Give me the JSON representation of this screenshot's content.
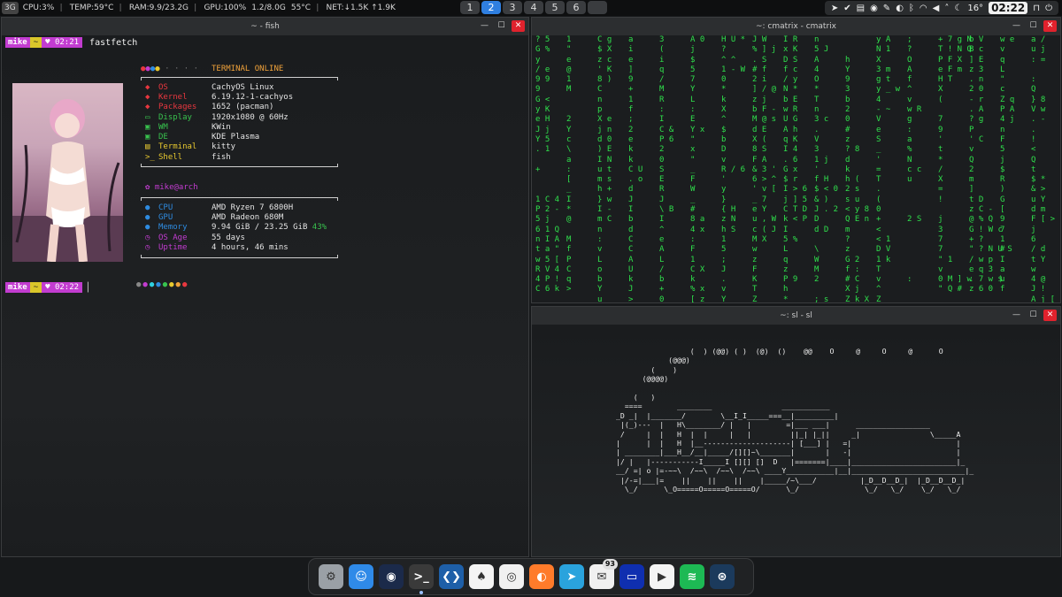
{
  "topbar": {
    "logo": "3G",
    "cpu": "CPU:3%",
    "temp": "TEMP:59°C",
    "ram": "RAM:9.9/23.2G",
    "gpu": "GPU:100%",
    "vram": "1.2/8.0G",
    "gpu_temp": "55°C",
    "net": "NET:↓1.5K ↑1.9K",
    "workspaces": [
      "1",
      "2",
      "3",
      "4",
      "5",
      "6"
    ],
    "active_workspace": "2",
    "weather": "16°",
    "clock": "02:22"
  },
  "fish_window": {
    "title": "~ - fish",
    "prompt": {
      "user": "mike",
      "dir": "~",
      "time1": "02:21",
      "time2": "02:22",
      "heart": "♥"
    },
    "command": "fastfetch",
    "header": "TERMINAL ONLINE",
    "rows1": [
      {
        "icon": "",
        "label": "OS",
        "value": "CachyOS Linux",
        "color": "#e8373f"
      },
      {
        "icon": "",
        "label": "Kernel",
        "value": "6.19.12-1-cachyos",
        "color": "#e8373f"
      },
      {
        "icon": "",
        "label": "Packages",
        "value": "1652 (pacman)",
        "color": "#e8373f"
      },
      {
        "icon": "",
        "label": "Display",
        "value": "1920x1080 @ 60Hz",
        "color": "#38c24e"
      },
      {
        "icon": "",
        "label": "WM",
        "value": "KWin",
        "color": "#38c24e"
      },
      {
        "icon": "",
        "label": "DE",
        "value": "KDE Plasma",
        "color": "#38c24e"
      },
      {
        "icon": "",
        "label": "Terminal",
        "value": "kitty",
        "color": "#e8c92f"
      },
      {
        "icon": "",
        "label": "Shell",
        "value": "fish",
        "color": "#e8c92f"
      }
    ],
    "user_host": "mike@arch",
    "rows2": [
      {
        "label": "CPU",
        "value": "AMD Ryzen 7 6800H",
        "color": "#2e8be0"
      },
      {
        "label": "GPU",
        "value": "AMD Radeon 680M",
        "color": "#2e8be0"
      },
      {
        "label": "Memory",
        "value": "9.94 GiB / 23.25 GiB",
        "extra": "43%",
        "color": "#2e8be0"
      },
      {
        "label": "OS Age",
        "value": "55 days",
        "color": "#c23cd0"
      },
      {
        "label": "Uptime",
        "value": "4 hours, 46 mins",
        "color": "#c23cd0"
      }
    ],
    "palette": [
      "#888888",
      "#c23cd0",
      "#2fd0e0",
      "#2e8be0",
      "#38c24e",
      "#e8c92f",
      "#f0a23a",
      "#e8373f"
    ]
  },
  "matrix_window": {
    "title": "~: cmatrix - cmatrix",
    "columns": [
      "? 5\nG %\ny\n/ e\n9 9\n9\nG <\ny K\ne H\nJ j\nY 5\n. 1\n\n+\n\n\n1 C 4\nP 2 -\n5 j\n6 1 Q\nn I A\nt a \"\nw 5 [\nR V 4\n4 P !\nC 6 k",
      "1\n\"\ne\n@\n1\nM\n\n\n2\nY\nc\n\\\na\n:\n[\n_\nI\n*\n@\n\nM\nf\nP\nC\nq\n>",
      "C g\n$ X\nz c\n' K\n8 )\nC\nn\np\nX e\nj n\nd 0\n) E\nI N\nu t\nm s\nh +\n} w\nI -\nm C\nn\n:\nv\nL\no\nb\nY\nu",
      "a\ni\ne\n]\n9\n+\n1\nf\n;\n2\ne\nk\nk\nC U\n. o\nd\nJ\nI\nb\nd\nC\nC\nA\nU\nk\nJ\n>",
      "3\n(\ni\nq\n/\nM\nR\n:\nI\nC &\nP 6\n2\n0\nS\nE\nR\nJ\n\\ B\nI\n^\ne\nA\nL\n/\nb\n+\n0",
      "A 0\nj\n$\n5\n7\nY\nL\n:\nE\nY x\n\"\nx\n\"\n_\nF\nW\n_\n#\n8 a\n4 x\n:\nF\n1\nC X\nk\n% x\n[ z",
      "H U *\n?\n^ ^\n1 - W\n0\n*\nk\nX\n^\n$\nb\nD\nv\nR / 6\n'\ny\n}\n{ H\nz N\nh S\n1\n5\n;\nJ\n.\nv\nY",
      "J W\n% ] j\n. S\n# f\n2 i\n] / @\nz j\nb F -\nM @ s\nd E\nX (\n8 S\nF A\n& 3 '\n6 > ^\n' v [\n_ 7\ne Y\nu , W\nc ( J\nM X\nw\nz\nF\nK\nT\nZ",
      "I R\nx K\nD S\nf c\n/ y\nN *\nb E\nw R\nU G\nA h\nq K\nI 4\n. 6\nG x\n$ r\nI > 6\nj ] 5\nC T D\nk < P\nI\n5 %\nL\nq\nz\nP 9\nh\n*\n'",
      "n\n5 J\nA\n4\nO\n*\nT\nn\n3 c\n.\nV\n3\n1 j\n'\nf H\n$ < 0\n& )\nJ . 2\nD\nd D\n\n\\\nW\nM\n2\n\n; s",
      "\n\nh\nY\n9\n3\nb\n2\n0\n#\nz\n? 8\nd\nk\nh (\n2 s\ns u\n< y 8\nQ E n\nm\n?\nz\nG 2\nf :\n# C\nX j\nZ k X",
      "y A\nN 1\nX\n3 m\ng t\ny _ w\n4\n- ~\nV\ne\nS\n_\n'\n=\nT\n.\n(\n0\n+\n<\n< 1\nD V\n1 k\nT\nv\n^\nZ",
      ";\n?\nO\nA\nf\n^\nv\nw R\ng\n:\na\n%\nN\nc c\nu\n\n\n\n2 S\n\n\n\n\n\n:\n\n",
      "+ 7 g N\nT ! N Q\nP F X\ne F m\nH T\nX\n(\n\n7\n9\n'\nt\n*\n/\nX\n=\n!\n\nj\n3\n7\n7\n\" 1\nv\n0 M ] w\n\" Q #",
      "b V\nB c\n] E\nz 3\n. n\n2 0\n- r\n. A\n? g\nP\n' C\nv\nQ\n2\nm\n]\nt D\nz C -\n@ % Q\nG ! W c\n+ ?\n\" ? N U S\n/ w p\ne q 3\n. 7 w $\nz 6 0",
      "w e\nv\nq\nL\n\"\nc\nZ q\nP A\n4 j\nn\nF\n5\nj\n$\nR\n)\nG\n[\n9\n7\n1\n#\nI\na\nu\nf",
      "a /\nu j\n: =\n\n:\nQ\n} 8\nV w\n. -\n.\n!\n<\nQ\nt\n$ *\n& >\nu Y\nd m\nF [ > 0\nj\n6\n/ d\nt Y\nw\n4 @\nJ !\nA j [\ne n t"
    ]
  },
  "sl_window": {
    "title": "~: sl - sl",
    "train": "                 (  ) (@@) ( )  (@)  ()    @@    O     @     O     @      O\n            (@@@)\n        (    )\n      (@@@@)\n\n    (   )\n  ====        ________                ___________\n_D _|  |_______/        \\__I_I_____===__|_________|\n |(_)---  |   H\\________/ |   |        =|___ ___|      _________________\n /     |  |   H  |  |     |   |         ||_| |_||     _|                \\_____A\n|      |  |   H  |__--------------------| [___] |   =|                        |\n| ________|___H__/__|_____/[][]~\\_______|       |   -|                        |\n|/ |   |-----------I_____I [][] []  D   |=======|____|________________________|_\n__/ =| o |=-~~\\  /~~\\  /~~\\  /~~\\ ____Y___________|__|__________________________|_\n |/-=|___|=    ||    ||    ||    |_____/~\\___/          |_D__D__D_|  |_D__D__D_|\n  \\_/      \\_O=====O=====O=====O/      \\_/               \\_/   \\_/    \\_/   \\_/"
  },
  "dock": [
    {
      "name": "system-settings-icon",
      "label": "⚙",
      "bg": "#9aa0a6"
    },
    {
      "name": "finder-icon",
      "label": "☺",
      "bg": "#2f8ae8"
    },
    {
      "name": "discover-icon",
      "label": "◉",
      "bg": "#1b2a4a"
    },
    {
      "name": "terminal-icon",
      "label": ">_",
      "bg": "#3a3a3a"
    },
    {
      "name": "vscode-icon",
      "label": "❮❯",
      "bg": "#1e5fa8"
    },
    {
      "name": "mongodb-icon",
      "label": "♠",
      "bg": "#f4f4f4"
    },
    {
      "name": "chrome-icon",
      "label": "◎",
      "bg": "#f1f1f1"
    },
    {
      "name": "firefox-icon",
      "label": "◐",
      "bg": "#ff7b2a"
    },
    {
      "name": "telegram-icon",
      "label": "➤",
      "bg": "#2aa3dd"
    },
    {
      "name": "mailspring-icon",
      "label": "✉",
      "bg": "#f0f0f0",
      "badge": "93"
    },
    {
      "name": "monitor-icon",
      "label": "▭",
      "bg": "#0f2fb0"
    },
    {
      "name": "youtube-icon",
      "label": "▶",
      "bg": "#f4f4f4"
    },
    {
      "name": "spotify-icon",
      "label": "≋",
      "bg": "#1db954"
    },
    {
      "name": "steam-icon",
      "label": "⊛",
      "bg": "#1b3a5c"
    }
  ]
}
